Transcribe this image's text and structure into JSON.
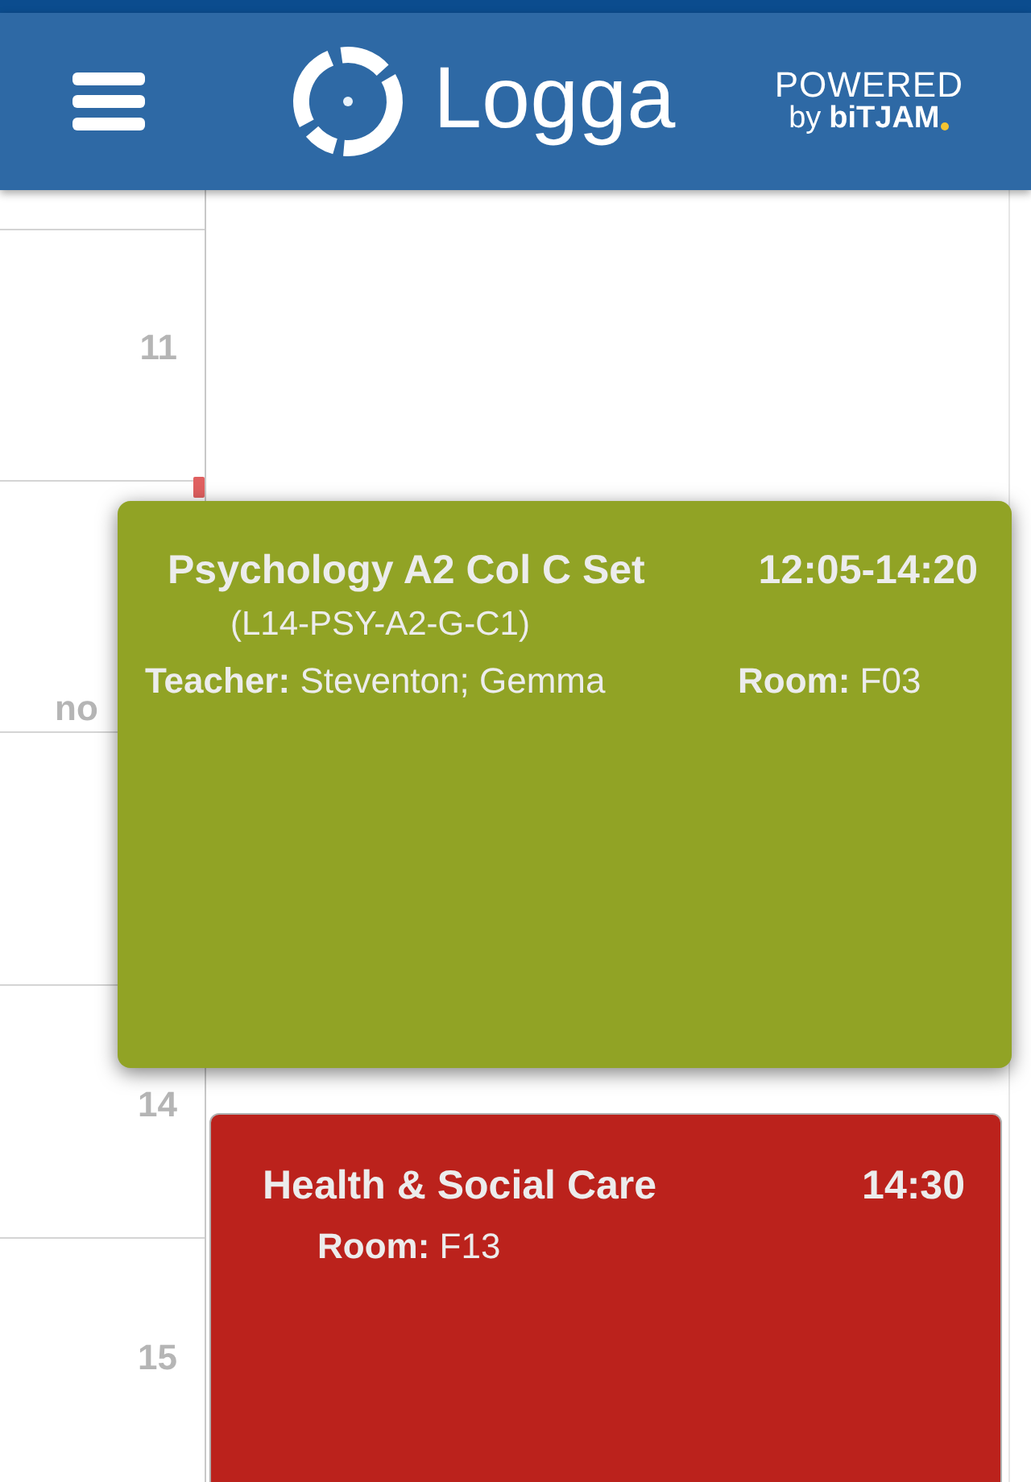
{
  "header": {
    "title": "Logga",
    "powered_by": "POWERED",
    "by": "by",
    "brand": "biTJAM"
  },
  "time_labels": [
    "11",
    "no",
    "14",
    "15"
  ],
  "events": [
    {
      "title": "Psychology A2 Col C Set",
      "time": "12:05-14:20",
      "code": "(L14-PSY-A2-G-C1)",
      "fields": [
        "**Teacher:** Steventon; Gemma",
        "**Room:** F03"
      ],
      "color": "#91a325",
      "expanded": true
    },
    {
      "title": "Health & Social Care",
      "time": "14:30",
      "fields": [
        "**Room:** F13"
      ],
      "color": "#bb221c",
      "expanded": false
    }
  ]
}
